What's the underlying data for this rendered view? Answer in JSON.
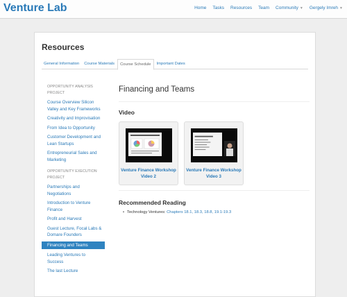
{
  "app": {
    "brand": "Venture Lab"
  },
  "nav": {
    "items": [
      "Home",
      "Tasks",
      "Resources",
      "Team",
      "Community",
      "Gergely Imreh"
    ]
  },
  "page": {
    "title": "Resources"
  },
  "tabs": [
    "General Information",
    "Course Materials",
    "Course Schedule",
    "Important Dates"
  ],
  "sidebar": {
    "section1": "Opportunity Analysis Project",
    "section1_items": [
      "Course Overview Silicon Valley and Key Frameworks",
      "Creativity and Improvisation",
      "From Idea to Opportunity",
      "Customer Development and Lean Startups",
      "Entrepreneurial Sales and Marketing"
    ],
    "section2": "Opportunity Execution Project",
    "section2_items": [
      "Partnerships and Negotiations",
      "Introduction to Venture Finance",
      "Profit and Harvest",
      "Guest Lecture, Focal Labs & Domare Founders",
      "Financing and Teams",
      "Leading Ventures to Success",
      "The last Lecture"
    ]
  },
  "content": {
    "title": "Financing and Teams",
    "video_heading": "Video",
    "videos": [
      "Venture Finance Workshop Video 2",
      "Venture Finance Workshop Video 3"
    ],
    "reading_heading": "Recommended Reading",
    "reading_text": "Technology Ventures: ",
    "reading_link": "Chapters 18.1, 18.3, 18.8, 19.1-19.3"
  }
}
